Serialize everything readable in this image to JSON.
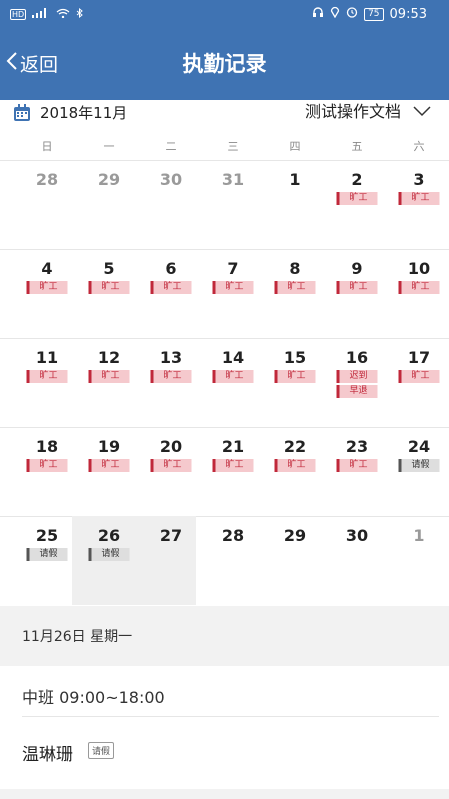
{
  "status_bar": {
    "left_icons": [
      "hd-icon",
      "signal-icon",
      "wifi-icon",
      "bluetooth-icon"
    ],
    "hd_label": "HD",
    "right_icons": [
      "headphone-icon",
      "location-icon",
      "alarm-icon"
    ],
    "battery": "75",
    "time": "09:53"
  },
  "nav": {
    "back_label": "返回",
    "title": "执勤记录"
  },
  "month_bar": {
    "month_label": "2018年11月",
    "doc_selector": "测试操作文档"
  },
  "weekdays": [
    "日",
    "一",
    "二",
    "三",
    "四",
    "五",
    "六"
  ],
  "calendar": {
    "weeks": [
      [
        {
          "day": "28",
          "dim": true,
          "tags": []
        },
        {
          "day": "29",
          "dim": true,
          "tags": []
        },
        {
          "day": "30",
          "dim": true,
          "tags": []
        },
        {
          "day": "31",
          "dim": true,
          "tags": []
        },
        {
          "day": "1",
          "tags": []
        },
        {
          "day": "2",
          "tags": [
            "旷工"
          ]
        },
        {
          "day": "3",
          "tags": [
            "旷工"
          ]
        }
      ],
      [
        {
          "day": "4",
          "tags": [
            "旷工"
          ]
        },
        {
          "day": "5",
          "tags": [
            "旷工"
          ]
        },
        {
          "day": "6",
          "tags": [
            "旷工"
          ]
        },
        {
          "day": "7",
          "tags": [
            "旷工"
          ]
        },
        {
          "day": "8",
          "tags": [
            "旷工"
          ]
        },
        {
          "day": "9",
          "tags": [
            "旷工"
          ]
        },
        {
          "day": "10",
          "tags": [
            "旷工"
          ]
        }
      ],
      [
        {
          "day": "11",
          "tags": [
            "旷工"
          ]
        },
        {
          "day": "12",
          "tags": [
            "旷工"
          ]
        },
        {
          "day": "13",
          "tags": [
            "旷工"
          ]
        },
        {
          "day": "14",
          "tags": [
            "旷工"
          ]
        },
        {
          "day": "15",
          "tags": [
            "旷工"
          ]
        },
        {
          "day": "16",
          "tags": [
            "迟到",
            "早退"
          ]
        },
        {
          "day": "17",
          "tags": [
            "旷工"
          ]
        }
      ],
      [
        {
          "day": "18",
          "tags": [
            "旷工"
          ]
        },
        {
          "day": "19",
          "tags": [
            "旷工"
          ]
        },
        {
          "day": "20",
          "tags": [
            "旷工"
          ]
        },
        {
          "day": "21",
          "tags": [
            "旷工"
          ]
        },
        {
          "day": "22",
          "tags": [
            "旷工"
          ]
        },
        {
          "day": "23",
          "tags": [
            "旷工"
          ]
        },
        {
          "day": "24",
          "tags": [
            "请假"
          ]
        }
      ],
      [
        {
          "day": "25",
          "tags": [
            "请假"
          ]
        },
        {
          "day": "26",
          "tags": [
            "请假"
          ],
          "selected": true
        },
        {
          "day": "27",
          "tags": []
        },
        {
          "day": "28",
          "tags": []
        },
        {
          "day": "29",
          "tags": []
        },
        {
          "day": "30",
          "tags": []
        },
        {
          "day": "1",
          "dim": true,
          "tags": []
        }
      ]
    ],
    "leave_tag": "请假"
  },
  "detail": {
    "date_line": "11月26日 星期一",
    "shift": "中班 09:00~18:00",
    "person": "温琳珊",
    "person_tag": "请假"
  },
  "colors": {
    "primary": "#3f73b3",
    "absent": "#c0283a",
    "absent_bg": "#f5c9cd",
    "leave_bg": "#dedede"
  }
}
